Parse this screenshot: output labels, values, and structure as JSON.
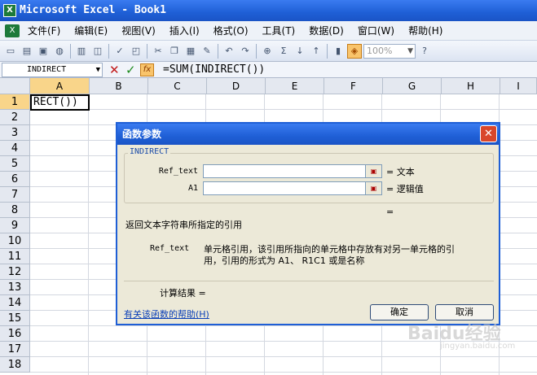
{
  "window": {
    "title": "Microsoft Excel - Book1"
  },
  "menu": [
    "文件(F)",
    "编辑(E)",
    "视图(V)",
    "插入(I)",
    "格式(O)",
    "工具(T)",
    "数据(D)",
    "窗口(W)",
    "帮助(H)"
  ],
  "toolbar": {
    "zoom_value": "100%"
  },
  "formula_bar": {
    "name_box": "INDIRECT",
    "formula": "=SUM(INDIRECT())"
  },
  "sheet": {
    "columns": [
      "A",
      "B",
      "C",
      "D",
      "E",
      "F",
      "G",
      "H",
      "I"
    ],
    "rows": [
      "1",
      "2",
      "3",
      "4",
      "5",
      "6",
      "7",
      "8",
      "9",
      "10",
      "11",
      "12",
      "13",
      "14",
      "15",
      "16",
      "17",
      "18"
    ],
    "active_cell_text": "RECT())"
  },
  "dialog": {
    "title": "函数参数",
    "function_name": "INDIRECT",
    "args": [
      {
        "label": "Ref_text",
        "value": "",
        "hint": "= 文本"
      },
      {
        "label": "A1",
        "value": "",
        "hint": "= 逻辑值"
      }
    ],
    "result_eq": "=",
    "description": "返回文本字符串所指定的引用",
    "param_name": "Ref_text",
    "param_desc_line1": "单元格引用，该引用所指向的单元格中存放有对另一单元格的引",
    "param_desc_line2": "用，引用的形式为 A1、 R1C1 或是名称",
    "calc_result": "计算结果 =",
    "help_link": "有关该函数的帮助(H)",
    "ok_label": "确定",
    "cancel_label": "取消"
  },
  "watermark": {
    "text": "Baidu经验",
    "sub": "jingyan.baidu.com"
  }
}
